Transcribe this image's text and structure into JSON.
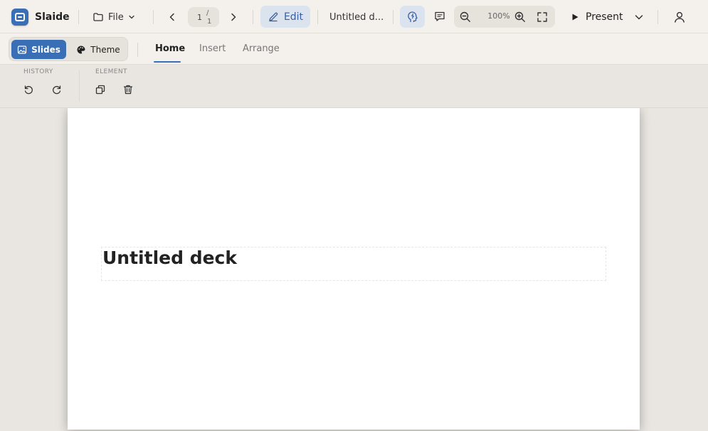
{
  "app": {
    "name": "Slaide"
  },
  "topbar": {
    "file_label": "File",
    "page_current": "1",
    "page_total": "1",
    "edit_label": "Edit",
    "deck_name": "Untitled d...",
    "zoom": "100%",
    "present_label": "Present"
  },
  "tabbar": {
    "slides_label": "Slides",
    "theme_label": "Theme",
    "tabs": [
      {
        "label": "Home",
        "active": true
      },
      {
        "label": "Insert",
        "active": false
      },
      {
        "label": "Arrange",
        "active": false
      }
    ]
  },
  "ribbon": {
    "history_label": "HISTORY",
    "element_label": "ELEMENT"
  },
  "slide": {
    "title": "Untitled deck"
  },
  "colors": {
    "accent": "#3a6fb5",
    "accent_soft": "#dbe3ee",
    "background": "#e9e6e1",
    "toolbar": "#f4f1ec"
  },
  "icons": {
    "logo": "slaide-logo-icon",
    "file": "folder-icon",
    "prev": "chevron-left-icon",
    "next": "chevron-right-icon",
    "edit": "pencil-icon",
    "ai": "ai-head-icon",
    "comment": "comment-icon",
    "zoom_out": "zoom-out-icon",
    "zoom_in": "zoom-in-icon",
    "fullscreen": "fullscreen-icon",
    "present": "play-icon",
    "user": "user-icon",
    "undo": "undo-icon",
    "redo": "redo-icon",
    "duplicate": "duplicate-icon",
    "delete": "trash-icon"
  }
}
